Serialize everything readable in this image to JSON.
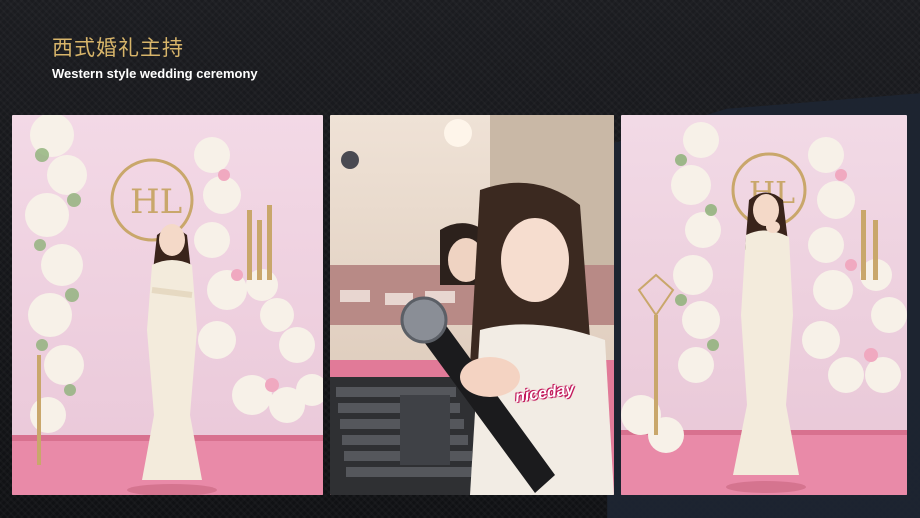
{
  "slide": {
    "title_cn": "西式婚礼主持",
    "title_en": "Western style wedding ceremony"
  },
  "photos": [
    {
      "subject": "host-standing-floral-arch-left"
    },
    {
      "subject": "host-selfie-with-microphone",
      "sticker": "niceday"
    },
    {
      "subject": "host-standing-floral-arch-right"
    }
  ],
  "colors": {
    "title_gold": "#d8b56a",
    "title_white": "#ffffff",
    "stage_pink": "#e98aa8",
    "background": "#121316"
  }
}
